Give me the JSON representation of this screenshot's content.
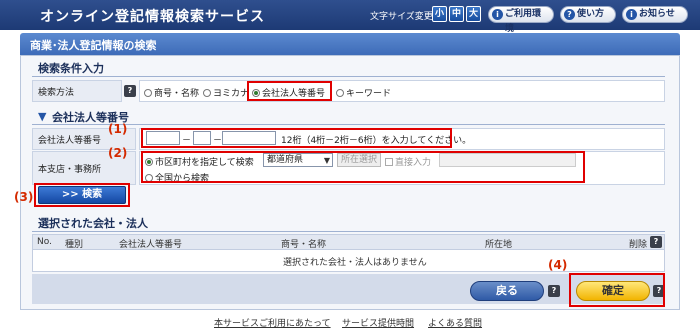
{
  "header": {
    "title": "オンライン登記情報検索サービス",
    "font_size_label": "文字サイズ変更",
    "font_sizes": [
      "小",
      "中",
      "大"
    ],
    "buttons": [
      {
        "label": "ご利用環境",
        "icon": "info-icon",
        "glyph": "i"
      },
      {
        "label": "使い方",
        "icon": "help-icon",
        "glyph": "?"
      },
      {
        "label": "お知らせ",
        "icon": "info-icon",
        "glyph": "i"
      }
    ]
  },
  "page_heading": "商業･法人登記情報の検索",
  "search_conditions": {
    "title": "検索条件入力",
    "method_label": "検索方法",
    "help_glyph": "?",
    "options": [
      "商号・名称",
      "ヨミカナ",
      "会社法人等番号",
      "キーワード"
    ],
    "selected_option": "会社法人等番号"
  },
  "corp_number_section": {
    "title": "会社法人等番号",
    "number_label": "会社法人等番号",
    "dash": "－",
    "hint": "12桁（4桁－2桁－6桁）を入力してください。",
    "office_label": "本支店・事務所",
    "office_options": [
      "市区町村を指定して検索",
      "全国から検索"
    ],
    "prefecture_select": "都道府県",
    "locate_button": "所在選択",
    "direct_input_label": "直接入力"
  },
  "search_button": ">> 検索",
  "selected_section": {
    "title": "選択された会社・法人",
    "columns": [
      "No.",
      "種別",
      "会社法人等番号",
      "商号・名称",
      "所在地",
      "削除"
    ],
    "empty_message": "選択された会社・法人はありません"
  },
  "actions": {
    "back_label": "戻る",
    "confirm_label": "確定"
  },
  "callouts": [
    "(1)",
    "(2)",
    "(3)",
    "(4)"
  ],
  "footer_links": [
    "本サービスご利用にあたって",
    "サービス提供時間",
    "よくある質問"
  ],
  "colors": {
    "header_bg": "#1d3a75",
    "accent_red": "#e00000",
    "confirm_yellow": "#f2b400"
  }
}
